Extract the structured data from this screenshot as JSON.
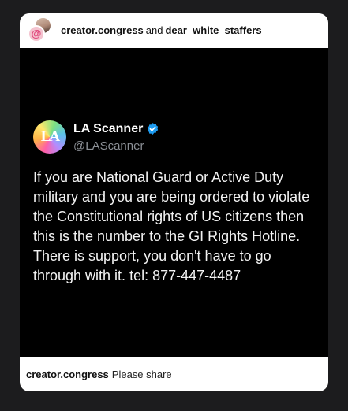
{
  "header": {
    "user_one": "creator.congress",
    "conjunction": "and",
    "user_two": "dear_white_staffers",
    "front_avatar_glyph": "@"
  },
  "tweet": {
    "avatar_text": "LA",
    "name": "LA Scanner",
    "handle": "@LAScanner",
    "verified_icon": "verified-badge-icon",
    "verified_color": "#1d9bf0",
    "body": "If you are National Guard or Active Duty military and you are being ordered to violate the Constitutional rights of US citizens then this is the number to the GI Rights Hotline. There is support, you don't have to go through with it. tel: 877-447-4487"
  },
  "caption": {
    "user": "creator.congress",
    "text": "Please share"
  }
}
